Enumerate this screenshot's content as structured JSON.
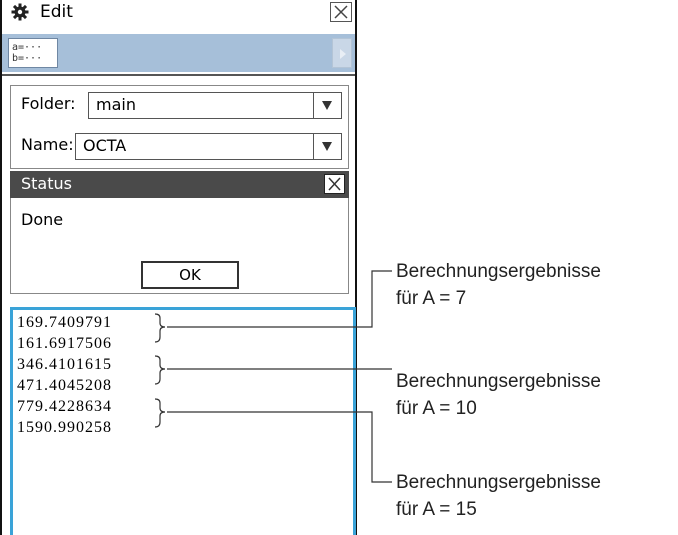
{
  "window": {
    "title": "Edit",
    "close_icon": "close-icon",
    "settings_icon": "gear-icon"
  },
  "toolbar": {
    "assign_button_text": "a=···\nb=···",
    "scroll_right_icon": "chevron-right-icon"
  },
  "form": {
    "folder_label": "Folder:",
    "folder_value": "main",
    "name_label": "Name:",
    "name_value": "OCTA"
  },
  "status_dialog": {
    "title": "Status",
    "message": "Done",
    "ok_label": "OK"
  },
  "results": [
    "169.7409791",
    "161.6917506",
    "346.4101615",
    "471.4045208",
    "779.4228634",
    "1590.990258"
  ],
  "annotations": [
    {
      "line1": "Berechnungsergebnisse",
      "line2": "für A = 7"
    },
    {
      "line1": "Berechnungsergebnisse",
      "line2": "für A = 10"
    },
    {
      "line1": "Berechnungsergebnisse",
      "line2": "für A = 15"
    }
  ],
  "colors": {
    "toolbar": "#a6bfd9",
    "status_header": "#4a4a4a",
    "results_border": "#3aa3d8"
  }
}
